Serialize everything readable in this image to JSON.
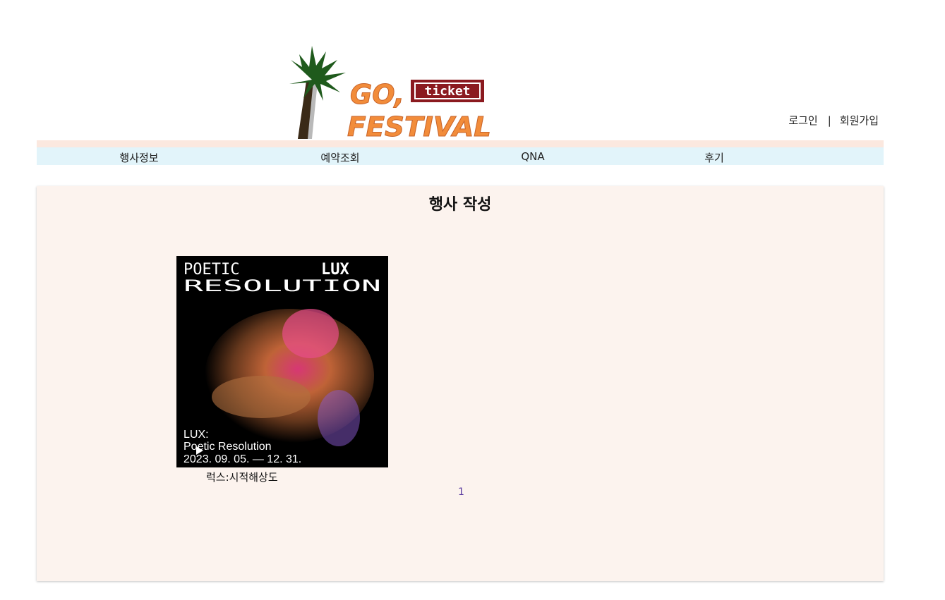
{
  "logo": {
    "line1": "GO,",
    "ticket": "ticket",
    "line2": "FESTIVAL"
  },
  "auth": {
    "login": "로그인",
    "separator": "|",
    "signup": "회원가입"
  },
  "nav": {
    "items": [
      {
        "label": "행사정보"
      },
      {
        "label": "예약조회"
      },
      {
        "label": "QNA"
      },
      {
        "label": "후기"
      }
    ]
  },
  "main": {
    "title": "행사 작성",
    "events": [
      {
        "title": "럭스:시적해상도",
        "poster": {
          "heading_line1": "POETIC",
          "heading_brand": "LUX",
          "heading_line2": "RESOLUTION",
          "caption_line1": "LUX:",
          "caption_line2": "Poetic Resolution",
          "caption_line3": "2023. 09. 05. — 12. 31."
        }
      }
    ],
    "pagination": {
      "current": "1"
    }
  },
  "colors": {
    "nav_bg": "#e2f4fa",
    "nav_strip": "#fbe8df",
    "panel_bg": "#fcf3ee",
    "logo_orange": "#f28c3a",
    "ticket_red": "#8b1a1f",
    "palm_green": "#1f5a1c"
  }
}
